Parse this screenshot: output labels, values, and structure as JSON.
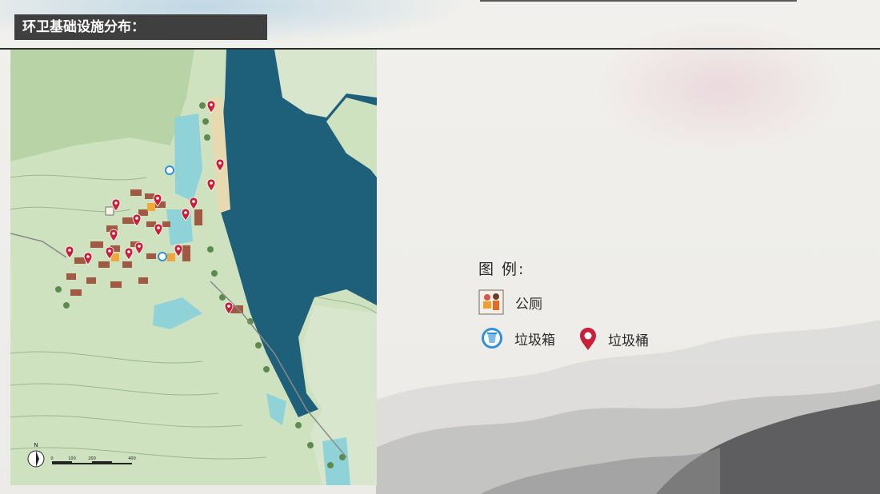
{
  "title": "环卫基础设施分布：",
  "legend": {
    "title": "图  例:",
    "items": [
      {
        "label": "公厕",
        "icon": "toilet-icon"
      },
      {
        "label": "垃圾箱",
        "icon": "trash-box-icon"
      },
      {
        "label": "垃圾桶",
        "icon": "trash-bin-pin-icon"
      }
    ]
  },
  "colors": {
    "title_bar": "#3f3f3f",
    "water": "#1e5f7a",
    "land": "#cfe2c0",
    "pin": "#c8203a",
    "trash_box": "#2f8fd8"
  },
  "map": {
    "north_label": "N",
    "scale_ticks": [
      "0",
      "100",
      "200",
      "400"
    ]
  }
}
